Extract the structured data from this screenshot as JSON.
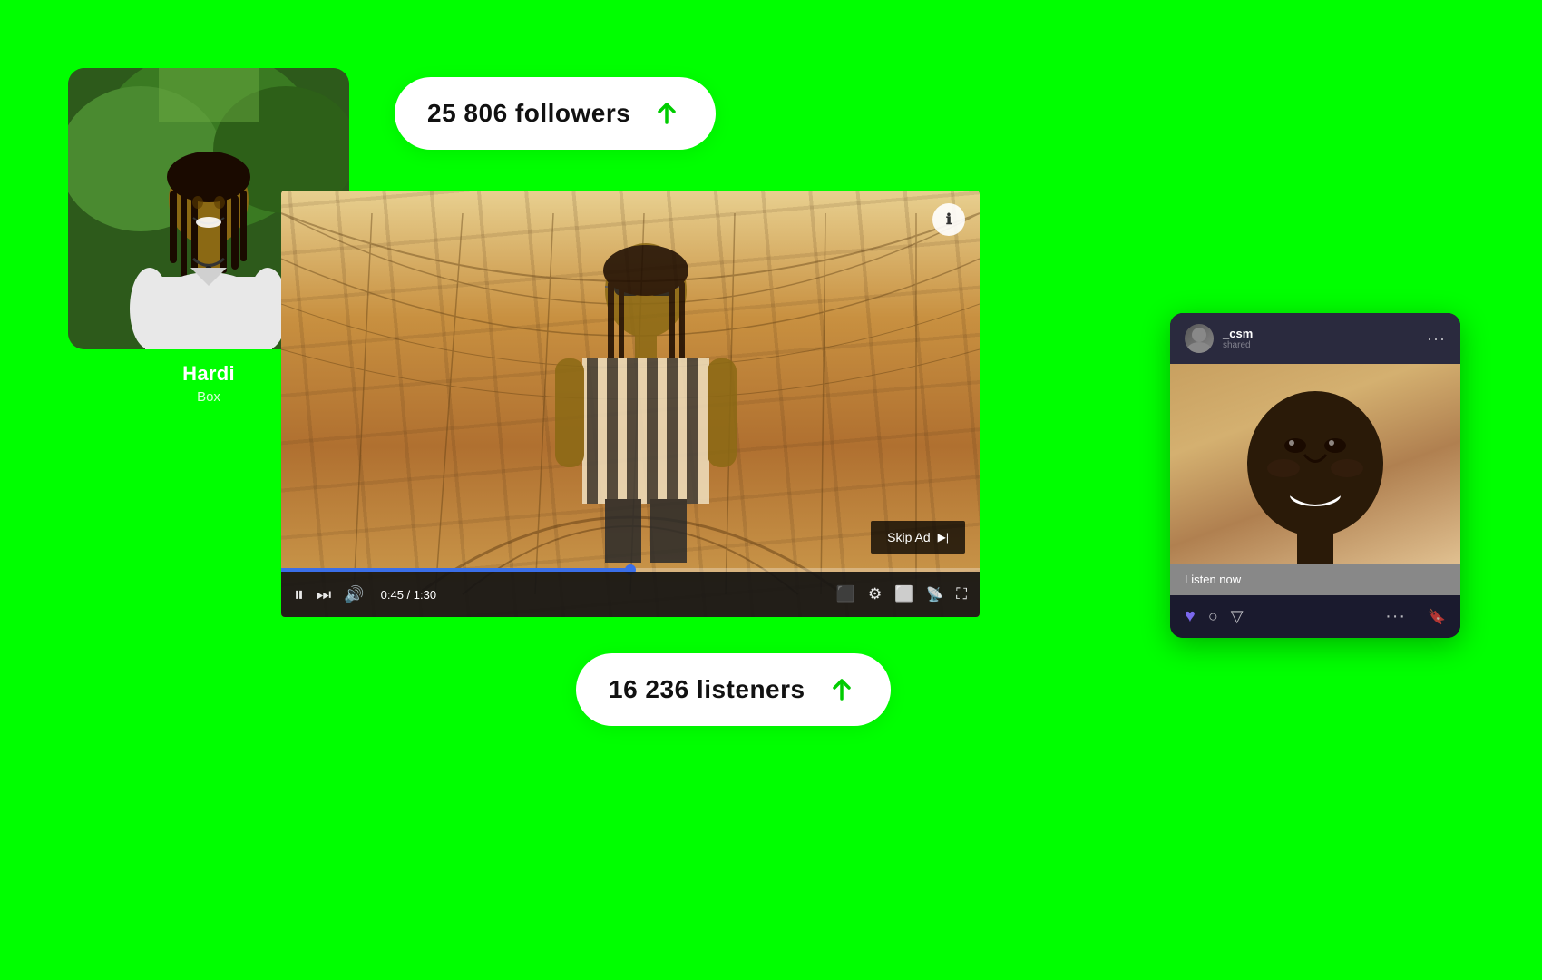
{
  "background": {
    "color": "#00FF00"
  },
  "artist_card": {
    "name": "Hardi",
    "subtitle": "Box",
    "photo_alt": "Hardi artist photo"
  },
  "followers_badge": {
    "text": "25 806 followers",
    "icon": "arrow-up"
  },
  "listeners_badge": {
    "text": "16 236 listeners",
    "icon": "arrow-up"
  },
  "video_player": {
    "time_current": "0:45",
    "time_total": "1:30",
    "time_display": "0:45 / 1:30",
    "progress_percent": 50,
    "skip_ad_label": "Skip Ad",
    "info_icon": "ℹ",
    "controls": {
      "pause": "⏸",
      "next": "⏭",
      "volume": "🔊",
      "subtitles": "⬛",
      "settings": "⚙",
      "miniplayer": "⬜",
      "cast": "📡",
      "fullscreen": "⛶"
    }
  },
  "spotify_card": {
    "username": "_csm",
    "meta": "...",
    "listen_now_label": "Listen now",
    "dots_menu": "···",
    "actions": {
      "heart": "♥",
      "circle": "○",
      "filter": "⊲",
      "more": "···",
      "bookmark": "🔖"
    }
  }
}
